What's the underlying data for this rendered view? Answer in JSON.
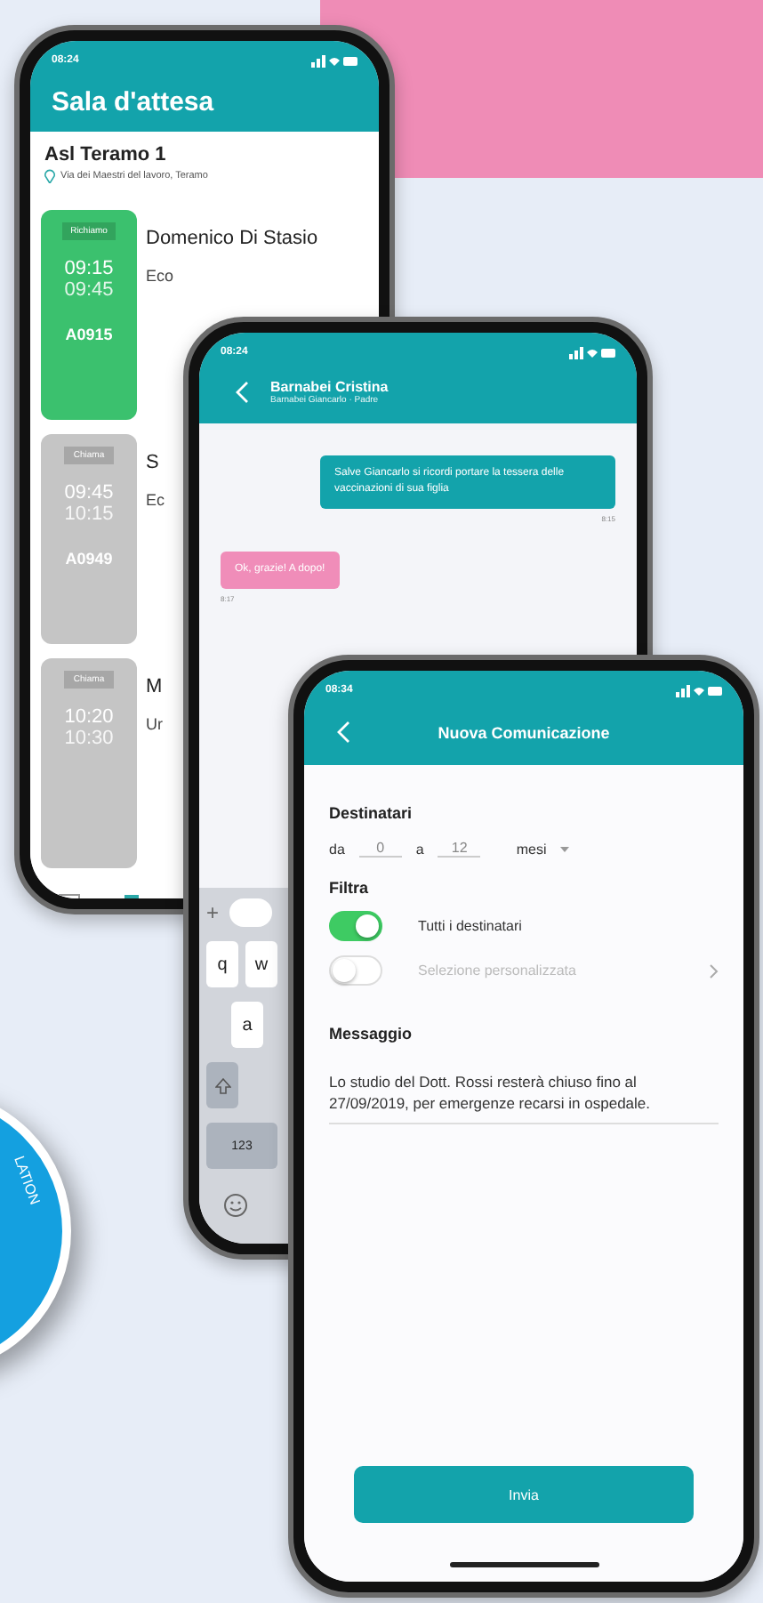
{
  "badge": {
    "text": "LATION"
  },
  "waiting_room": {
    "status_time": "08:24",
    "title": "Sala d'attesa",
    "location": {
      "name": "Asl Teramo 1",
      "address": "Via dei Maestri del lavoro, Teramo"
    },
    "tickets": [
      {
        "kind": "called",
        "status": "Richiamo",
        "start": "09:15",
        "end": "09:45",
        "code": "A0915",
        "name": "Domenico Di Stasio",
        "subtitle": "Eco"
      },
      {
        "kind": "waiting",
        "status": "Chiama",
        "start": "09:45",
        "end": "10:15",
        "code": "A0949",
        "name": "S",
        "subtitle": "Ec"
      },
      {
        "kind": "waiting",
        "status": "Chiama",
        "start": "10:20",
        "end": "10:30",
        "name": "M",
        "subtitle": "Ur"
      }
    ]
  },
  "chat": {
    "status_time": "08:24",
    "contact": "Barnabei Cristina",
    "subtitle": "Barnabei Giancarlo · Padre",
    "messages": [
      {
        "kind": "sent",
        "text": "Salve Giancarlo si ricordi portare la tessera delle vaccinazioni di sua figlia",
        "time": "8:15"
      },
      {
        "kind": "received",
        "text": "Ok, grazie! A dopo!",
        "time": "8:17"
      }
    ],
    "keyboard": {
      "plus": "+",
      "rows": [
        [
          "q",
          "w"
        ],
        [
          "a"
        ]
      ],
      "numbers_key": "123"
    }
  },
  "new_message": {
    "status_time": "08:34",
    "title": "Nuova Comunicazione",
    "recipients": {
      "label": "Destinatari",
      "from_label": "da",
      "from": "0",
      "to_label": "a",
      "to": "12",
      "unit": "mesi"
    },
    "filter": {
      "label": "Filtra",
      "options": [
        {
          "label": "Tutti i destinatari",
          "on": true
        },
        {
          "label": "Selezione personalizzata",
          "on": false
        }
      ]
    },
    "message": {
      "label": "Messaggio",
      "value": "Lo studio del Dott. Rossi resterà chiuso fino al 27/09/2019, per emergenze recarsi in ospedale."
    },
    "send_button": "Invia"
  }
}
